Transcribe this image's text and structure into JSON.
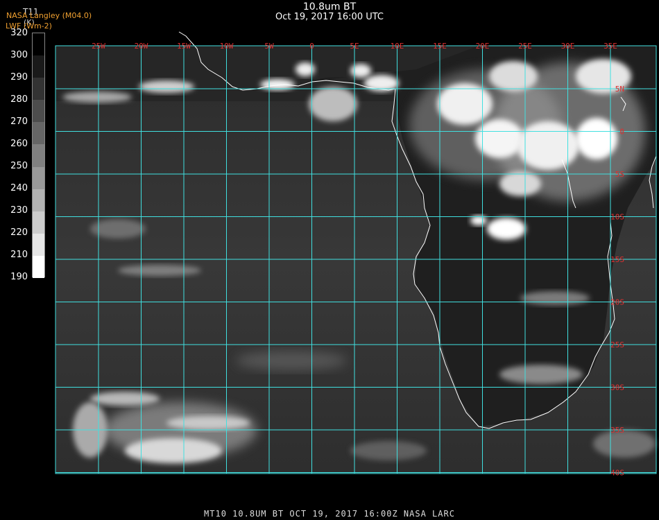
{
  "header": {
    "title": "10.8um BT",
    "datetime": "Oct 19, 2017 16:00 UTC"
  },
  "legend": {
    "variable": "T11",
    "organization": "NASA Langley (M04.0)",
    "product": "LWF (Wm-2)",
    "unit": "(K)",
    "ticks": [
      "320",
      "300",
      "290",
      "280",
      "270",
      "260",
      "250",
      "240",
      "230",
      "220",
      "210",
      "190"
    ],
    "colors": [
      "#000000",
      "#1a1a1a",
      "#333333",
      "#4d4d4d",
      "#666666",
      "#808080",
      "#999999",
      "#b3b3b3",
      "#cccccc",
      "#e6e6e6",
      "#ffffff"
    ]
  },
  "map": {
    "grid_color": "#40e0e0",
    "label_color": "#e03030",
    "lon_labels": [
      "25W",
      "20W",
      "15W",
      "10W",
      "5W",
      "0",
      "5E",
      "10E",
      "15E",
      "20E",
      "25E",
      "30E",
      "35E"
    ],
    "lat_labels": [
      "5N",
      "0",
      "5S",
      "10S",
      "15S",
      "20S",
      "25S",
      "30S",
      "35S",
      "40S"
    ]
  },
  "footer": {
    "caption": "MT10   10.8UM BT   OCT 19, 2017 16:00Z   NASA LARC"
  }
}
